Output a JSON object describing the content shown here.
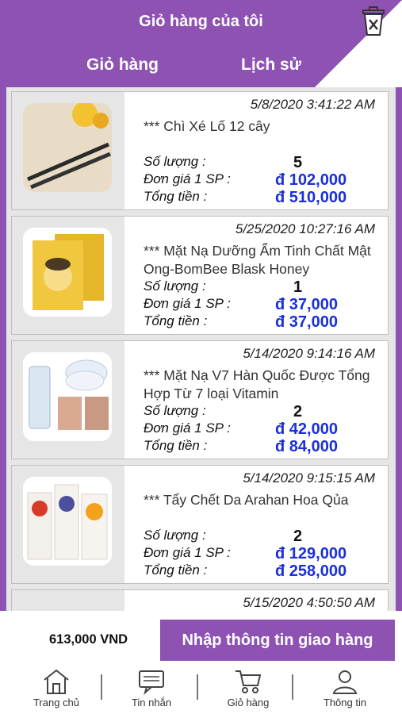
{
  "header": {
    "title": "Giỏ hàng của tôi",
    "tabs": [
      "Giỏ hàng",
      "Lịch sử"
    ],
    "trash_icon": "trash-icon"
  },
  "orders": [
    {
      "date": "5/8/2020 3:41:22 AM",
      "name": "*** Chì Xé Lố 12 cây",
      "qty_label": "Số lượng :",
      "qty": "5",
      "unit_label": "Đơn giá 1 SP :",
      "unit_price": "đ 102,000",
      "total_label": "Tổng tiền :",
      "total": "đ 510,000"
    },
    {
      "date": "5/25/2020 10:27:16 AM",
      "name": "*** Mặt Nạ Dưỡng Ẩm Tinh Chất Mật Ong-BomBee Blask Honey",
      "qty_label": "Số lượng :",
      "qty": "1",
      "unit_label": "Đơn giá 1 SP :",
      "unit_price": "đ 37,000",
      "total_label": "Tổng tiền :",
      "total": "đ 37,000"
    },
    {
      "date": "5/14/2020 9:14:16 AM",
      "name": "*** Mặt Nạ V7 Hàn Quốc Được Tổng Hợp Từ 7 loại Vitamin",
      "qty_label": "Số lượng :",
      "qty": "2",
      "unit_label": "Đơn giá 1 SP :",
      "unit_price": "đ 42,000",
      "total_label": "Tổng tiền :",
      "total": "đ 84,000"
    },
    {
      "date": "5/14/2020 9:15:15 AM",
      "name": "*** Tẩy Chết Da Arahan Hoa Qủa",
      "qty_label": "Số lượng :",
      "qty": "2",
      "unit_label": "Đơn giá 1 SP :",
      "unit_price": "đ 129,000",
      "total_label": "Tổng tiền :",
      "total": "đ 258,000"
    },
    {
      "date": "5/15/2020 4:50:50 AM"
    }
  ],
  "footer": {
    "total": "613,000 VND",
    "checkout_label": "Nhập thông tin giao hàng"
  },
  "nav": [
    {
      "label": "Trang chủ",
      "icon": "home-icon"
    },
    {
      "label": "Tin nhắn",
      "icon": "message-icon"
    },
    {
      "label": "Giỏ hàng",
      "icon": "cart-icon"
    },
    {
      "label": "Thông tin",
      "icon": "user-icon"
    }
  ],
  "colors": {
    "accent": "#8e53b2",
    "price": "#1a2fd8"
  }
}
